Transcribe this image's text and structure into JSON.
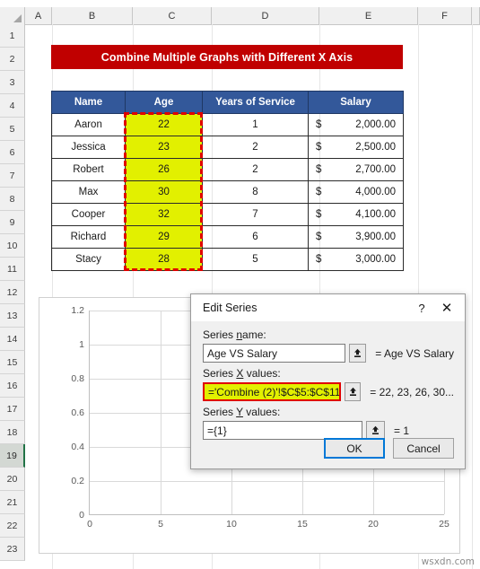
{
  "spreadsheet": {
    "column_headers": [
      "A",
      "B",
      "C",
      "D",
      "E",
      "F"
    ],
    "row_headers": [
      "1",
      "2",
      "3",
      "4",
      "5",
      "6",
      "7",
      "8",
      "9",
      "10",
      "11",
      "12",
      "13",
      "14",
      "15",
      "16",
      "17",
      "18",
      "19",
      "20",
      "21",
      "22",
      "23"
    ],
    "selected_row": "19",
    "banner_title": "Combine Multiple Graphs with Different X Axis",
    "banner_color": "#C00000",
    "header_color": "#33589A",
    "highlight_color": "#E2F000",
    "selection_color": "#E00000"
  },
  "table": {
    "headers": [
      "Name",
      "Age",
      "Years of Service",
      "Salary"
    ],
    "rows": [
      {
        "name": "Aaron",
        "age": "22",
        "years": "1",
        "currency": "$",
        "salary": "2,000.00"
      },
      {
        "name": "Jessica",
        "age": "23",
        "years": "2",
        "currency": "$",
        "salary": "2,500.00"
      },
      {
        "name": "Robert",
        "age": "26",
        "years": "2",
        "currency": "$",
        "salary": "2,700.00"
      },
      {
        "name": "Max",
        "age": "30",
        "years": "8",
        "currency": "$",
        "salary": "4,000.00"
      },
      {
        "name": "Cooper",
        "age": "32",
        "years": "7",
        "currency": "$",
        "salary": "4,100.00"
      },
      {
        "name": "Richard",
        "age": "29",
        "years": "6",
        "currency": "$",
        "salary": "3,900.00"
      },
      {
        "name": "Stacy",
        "age": "28",
        "years": "5",
        "currency": "$",
        "salary": "3,000.00"
      }
    ]
  },
  "chart_data": {
    "type": "scatter",
    "title": "",
    "xlabel": "",
    "ylabel": "",
    "xlim": [
      0,
      25
    ],
    "ylim": [
      0,
      1.2
    ],
    "xticks": [
      "0",
      "5",
      "10",
      "15",
      "20",
      "25"
    ],
    "yticks": [
      "0",
      "0.2",
      "0.4",
      "0.6",
      "0.8",
      "1",
      "1.2"
    ],
    "grid": true,
    "legend": "none",
    "series": [
      {
        "name": "Age VS Salary",
        "x": [
          22,
          23,
          26,
          30,
          32,
          29,
          28
        ],
        "y": [
          1
        ]
      }
    ]
  },
  "watermark": "wsxdn.com",
  "dialog": {
    "title": "Edit Series",
    "help_label": "?",
    "close_label": "✕",
    "series_name_label": "Series name:",
    "series_name_label_pre": "Series ",
    "series_name_label_key": "n",
    "series_name_label_post": "ame:",
    "series_name_value": "Age VS Salary",
    "series_name_result": "= Age VS Salary",
    "series_x_label_pre": "Series ",
    "series_x_label_key": "X",
    "series_x_label_post": " values:",
    "series_x_value": "='Combine (2)'!$C$5:$C$11",
    "series_x_result": "= 22, 23, 26, 30...",
    "series_y_label_pre": "Series ",
    "series_y_label_key": "Y",
    "series_y_label_post": " values:",
    "series_y_value": "={1}",
    "series_y_result": "= 1",
    "ok_label": "OK",
    "cancel_label": "Cancel"
  }
}
